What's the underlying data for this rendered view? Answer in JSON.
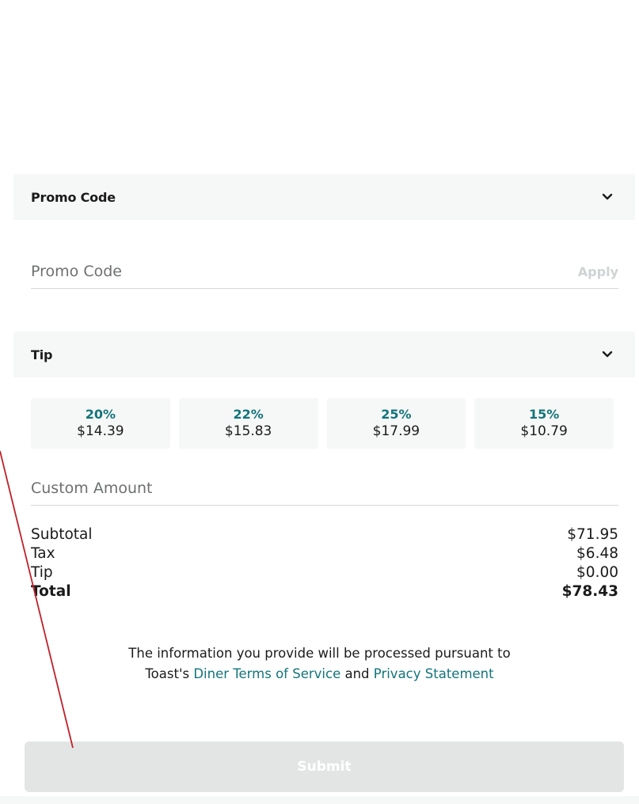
{
  "promo_section": {
    "title": "Promo Code",
    "input_placeholder": "Promo Code",
    "apply_label": "Apply"
  },
  "tip_section": {
    "title": "Tip",
    "options": [
      {
        "percent": "20%",
        "amount": "$14.39"
      },
      {
        "percent": "22%",
        "amount": "$15.83"
      },
      {
        "percent": "25%",
        "amount": "$17.99"
      },
      {
        "percent": "15%",
        "amount": "$10.79"
      }
    ],
    "custom_placeholder": "Custom Amount"
  },
  "summary": {
    "subtotal_label": "Subtotal",
    "subtotal_value": "$71.95",
    "tax_label": "Tax",
    "tax_value": "$6.48",
    "tip_label": "Tip",
    "tip_value": "$0.00",
    "total_label": "Total",
    "total_value": "$78.43"
  },
  "legal": {
    "line1": "The information you provide will be processed pursuant to",
    "line2_prefix": "Toast's ",
    "terms_link": "Diner Terms of Service",
    "and": " and ",
    "privacy_link": "Privacy Statement"
  },
  "submit_label": "Submit",
  "colors": {
    "accent": "#13747a",
    "panel": "#f6f7f7",
    "annotation_line": "#c0202a",
    "submit_disabled": "#e3e5e5"
  }
}
